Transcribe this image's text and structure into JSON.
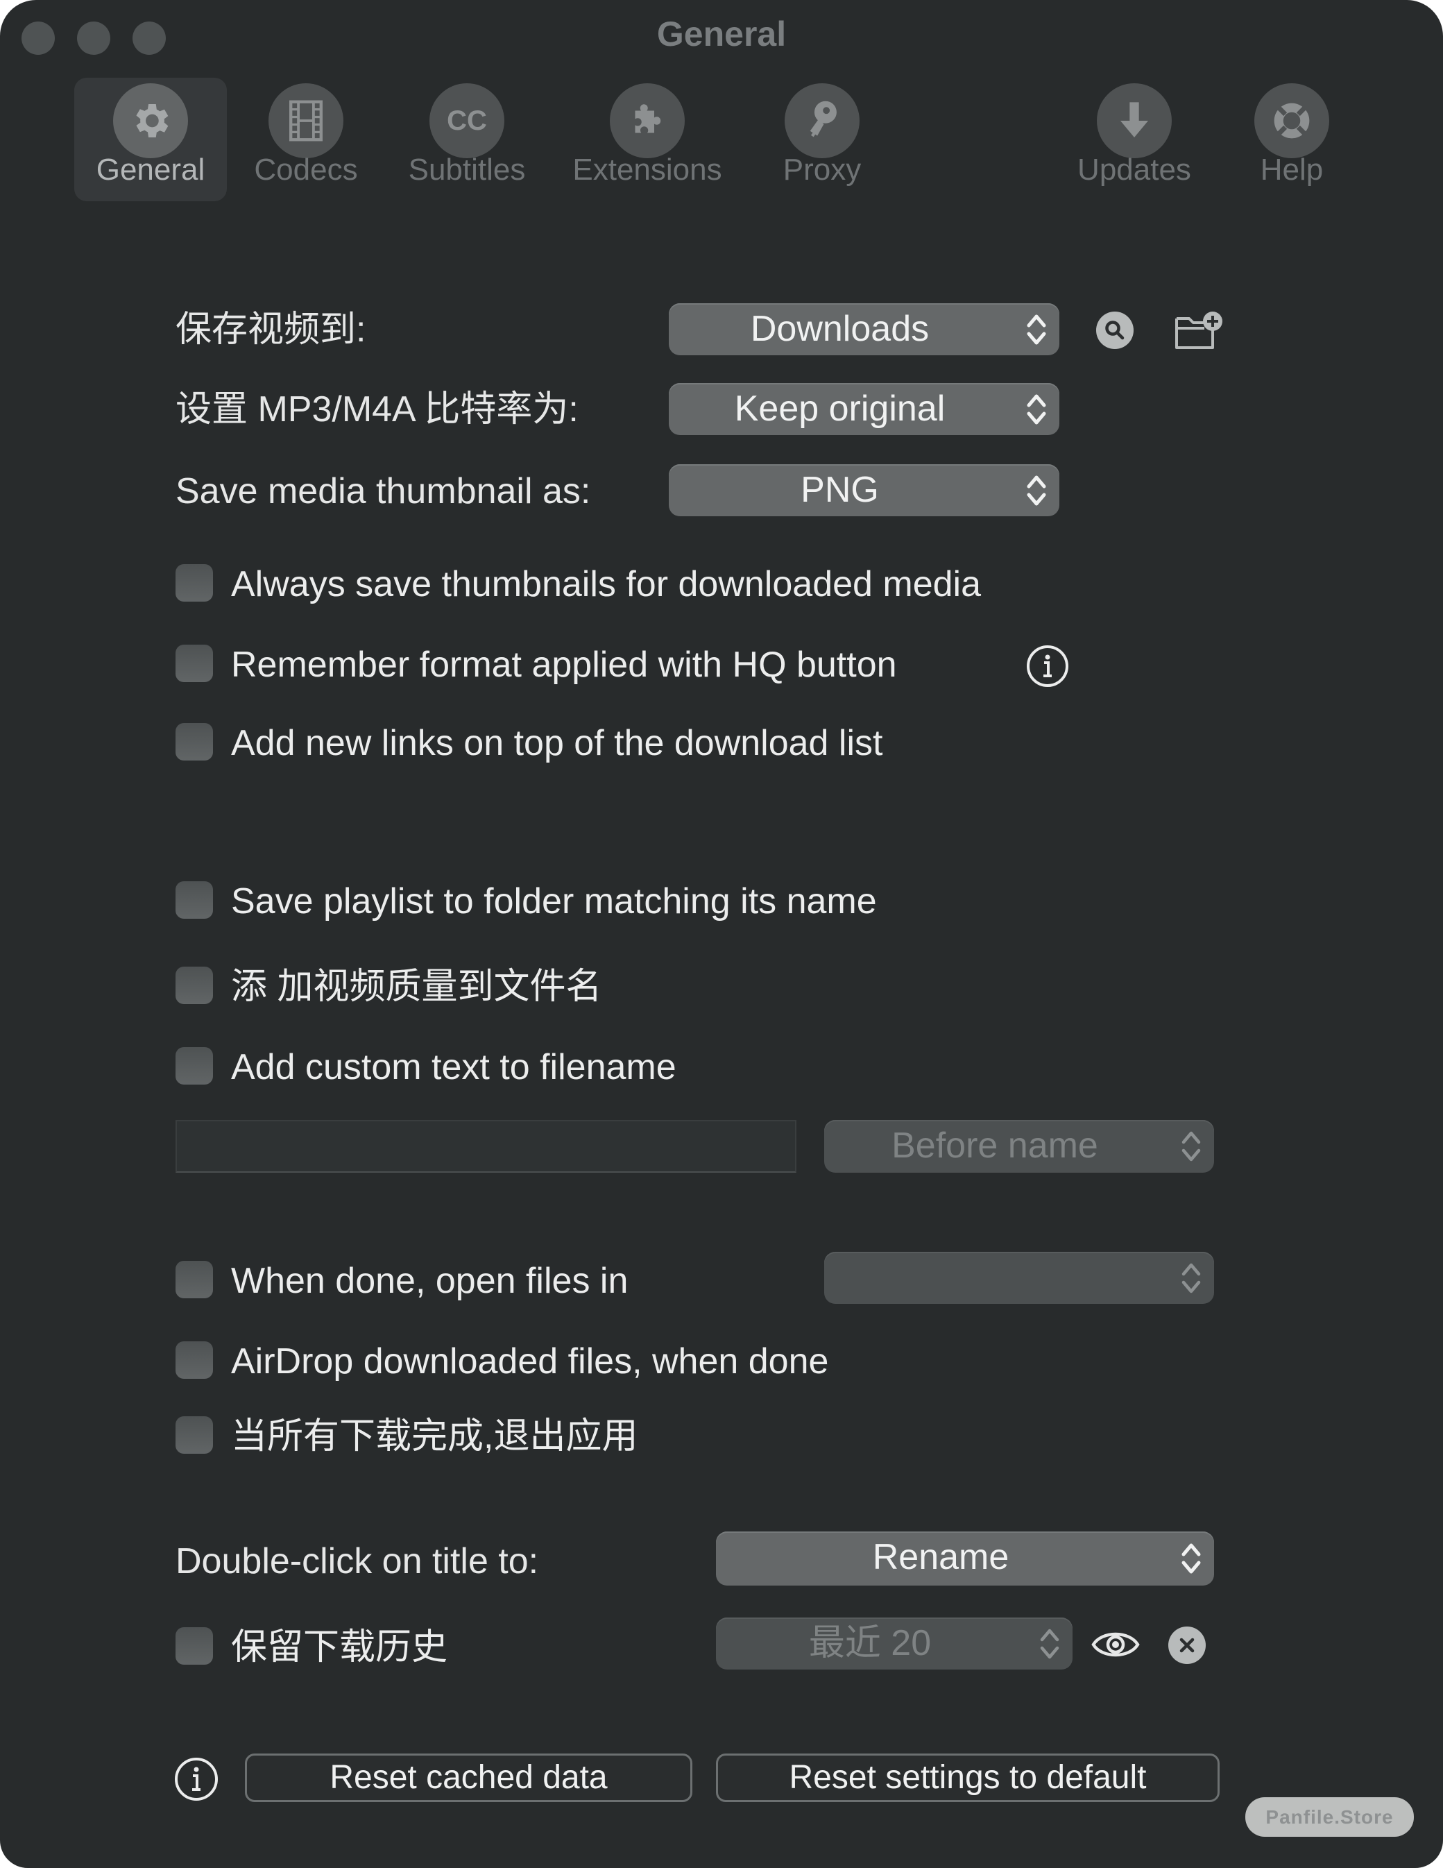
{
  "window": {
    "title": "General"
  },
  "toolbar": {
    "items": [
      {
        "label": "General",
        "icon": "gear-icon",
        "selected": true
      },
      {
        "label": "Codecs",
        "icon": "film-icon",
        "selected": false
      },
      {
        "label": "Subtitles",
        "icon": "cc-icon",
        "selected": false
      },
      {
        "label": "Extensions",
        "icon": "puzzle-icon",
        "selected": false
      },
      {
        "label": "Proxy",
        "icon": "key-icon",
        "selected": false
      },
      {
        "label": "Updates",
        "icon": "download-arrow-icon",
        "selected": false
      },
      {
        "label": "Help",
        "icon": "lifebuoy-icon",
        "selected": false
      }
    ],
    "cc_glyph": "CC"
  },
  "settings": {
    "save_to_label": "保存视频到:",
    "save_to_value": "Downloads",
    "bitrate_label": "设置 MP3/M4A 比特率为:",
    "bitrate_value": "Keep original",
    "thumbnail_label": "Save media thumbnail as:",
    "thumbnail_value": "PNG",
    "checkboxes": [
      {
        "label": "Always save thumbnails for downloaded media",
        "checked": false
      },
      {
        "label": "Remember format applied with HQ button",
        "checked": false
      },
      {
        "label": "Add new links on top of the download list",
        "checked": false
      },
      {
        "label": "Save playlist to folder matching its name",
        "checked": false
      },
      {
        "label": "添 加视频质量到文件名",
        "checked": false
      },
      {
        "label": "Add custom text to filename",
        "checked": false
      },
      {
        "label": "When done, open files in",
        "checked": false
      },
      {
        "label": "AirDrop downloaded files, when done",
        "checked": false
      },
      {
        "label": "当所有下载完成,退出应用",
        "checked": false
      },
      {
        "label": "保留下载历史",
        "checked": false
      }
    ],
    "custom_text_value": "",
    "custom_text_position": "Before name",
    "open_files_in_value": "",
    "double_click_label": "Double-click on title to:",
    "double_click_value": "Rename",
    "history_value": "最近 20"
  },
  "footer": {
    "reset_cache_label": "Reset cached data",
    "reset_settings_label": "Reset settings to default"
  },
  "watermark": "Panfile.Store"
}
